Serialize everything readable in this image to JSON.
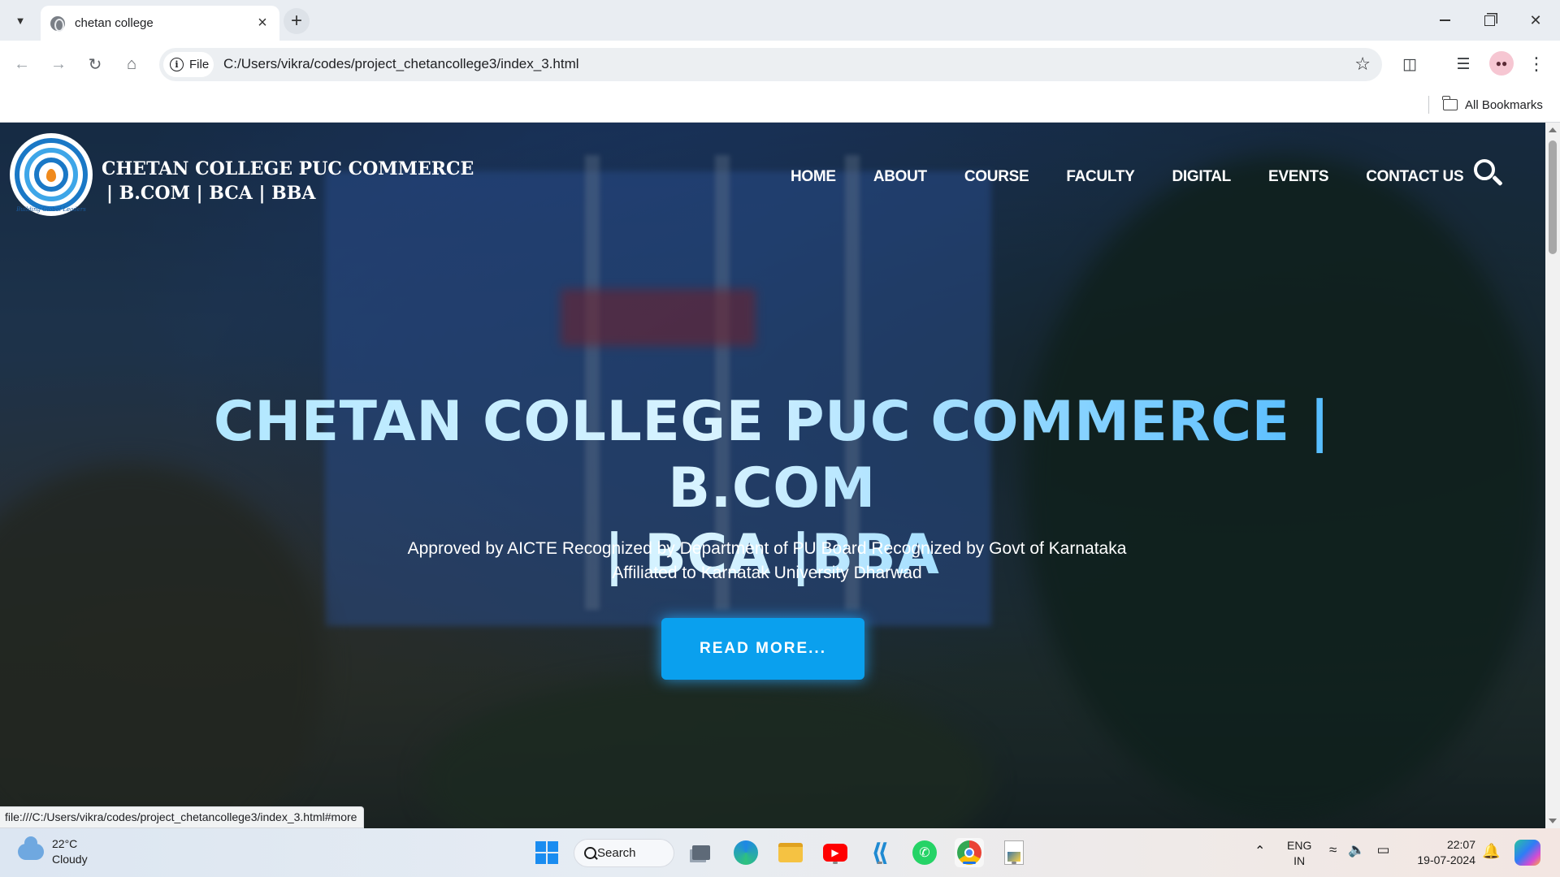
{
  "browser": {
    "tab_title": "chetan college",
    "address": "C:/Users/vikra/codes/project_chetancollege3/index_3.html",
    "site_chip_label": "File",
    "all_bookmarks": "All Bookmarks",
    "status_url": "file:///C:/Users/vikra/codes/project_chetancollege3/index_3.html#more"
  },
  "site": {
    "brand_line1": "CHETAN COLLEGE PUC COMMERCE",
    "brand_line2": "| B.COM | BCA | BBA",
    "logo_tagline": "Building Global Leaders",
    "nav": [
      {
        "label": "HOME"
      },
      {
        "label": "ABOUT"
      },
      {
        "label": "COURSE"
      },
      {
        "label": "FACULTY"
      },
      {
        "label": "DIGITAL"
      },
      {
        "label": "EVENTS"
      },
      {
        "label": "CONTACT US"
      }
    ],
    "hero": {
      "title_line1": "CHETAN COLLEGE PUC COMMERCE | B.COM",
      "title_line2": "| BCA |BBA",
      "subtitle_line1": "Approved by AICTE Recognized by Department of PU Board Recognized by Govt of Karnataka",
      "subtitle_line2": "Affiliated to Karnatak University Dharwad",
      "cta": "READ MORE..."
    }
  },
  "taskbar": {
    "weather_temp": "22°C",
    "weather_desc": "Cloudy",
    "search_label": "Search",
    "lang_line1": "ENG",
    "lang_line2": "IN",
    "time": "22:07",
    "date": "19-07-2024"
  },
  "colors": {
    "accent_button": "#0aa0ee",
    "hero_title_gradient_end": "#43b4ff",
    "logo_blue": "#1a78c6"
  }
}
